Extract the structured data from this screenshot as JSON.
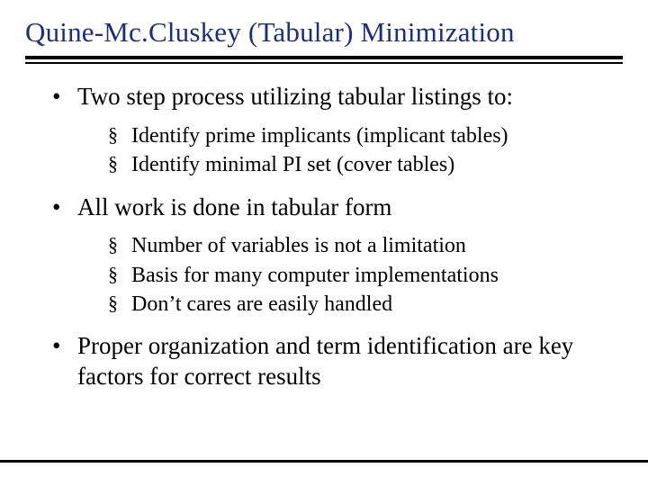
{
  "title": "Quine-Mc.Cluskey (Tabular) Minimization",
  "bullets": [
    {
      "text": "Two step process utilizing tabular listings to:",
      "sub": [
        "Identify prime implicants (implicant tables)",
        "Identify minimal PI set (cover tables)"
      ]
    },
    {
      "text": "All work is done in tabular form",
      "sub": [
        "Number of variables is not a limitation",
        "Basis for many computer implementations",
        "Don’t cares are easily handled"
      ]
    },
    {
      "text": "Proper organization and term identification are key factors for correct results",
      "sub": []
    }
  ]
}
